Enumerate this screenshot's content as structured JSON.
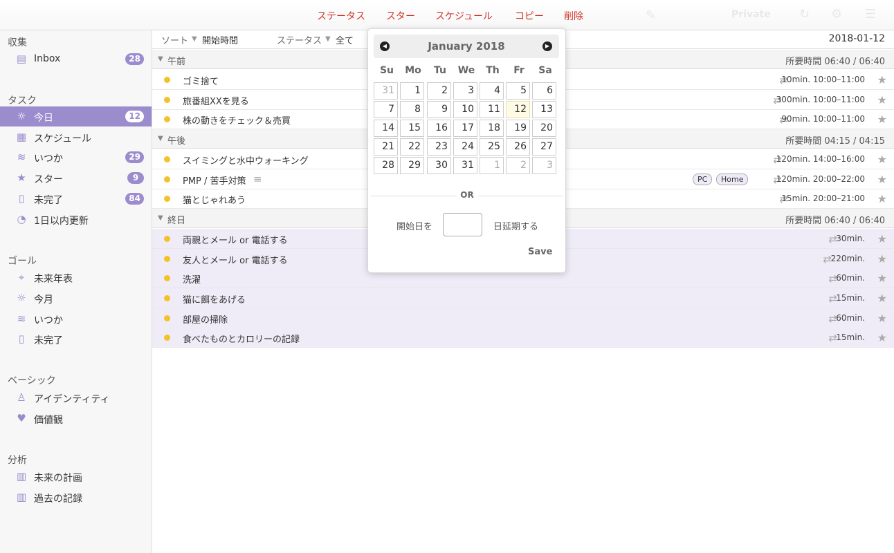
{
  "toolbar_links": [
    "ステータス",
    "スター",
    "スケジュール",
    "コピー",
    "削除"
  ],
  "header_right": {
    "privacy": "Private"
  },
  "sidebar": {
    "sections": [
      "収集",
      "タスク",
      "ゴール",
      "ベーシック",
      "分析"
    ],
    "items": [
      {
        "label": "Inbox",
        "badge": "28",
        "icon": "inbox-icon"
      },
      {
        "label": "今日",
        "badge": "12",
        "icon": "sun-icon"
      },
      {
        "label": "スケジュール",
        "badge": "",
        "icon": "calendar-icon"
      },
      {
        "label": "いつか",
        "badge": "29",
        "icon": "layers-icon"
      },
      {
        "label": "スター",
        "badge": "9",
        "icon": "star-icon"
      },
      {
        "label": "未完了",
        "badge": "84",
        "icon": "document-icon"
      },
      {
        "label": "1日以内更新",
        "badge": "",
        "icon": "stopwatch-icon"
      },
      {
        "label": "未来年表",
        "badge": "",
        "icon": "telescope-icon"
      },
      {
        "label": "今月",
        "badge": "",
        "icon": "sun-icon"
      },
      {
        "label": "いつか",
        "badge": "",
        "icon": "layers-icon"
      },
      {
        "label": "未完了",
        "badge": "",
        "icon": "document-icon"
      },
      {
        "label": "アイデンティティ",
        "badge": "",
        "icon": "person-icon"
      },
      {
        "label": "価値観",
        "badge": "",
        "icon": "heart-icon"
      },
      {
        "label": "未来の計画",
        "badge": "",
        "icon": "chart-icon"
      },
      {
        "label": "過去の記録",
        "badge": "",
        "icon": "chart-icon"
      }
    ]
  },
  "list_toolbar": {
    "sort_label": "ソート",
    "sort_value": "開始時間",
    "status_label": "ステータス",
    "status_value": "全て",
    "date": "2018-01-12"
  },
  "groups": [
    {
      "title": "午前",
      "duration": "所要時間 06:40 / 06:40"
    },
    {
      "title": "午後",
      "duration": "所要時間 04:15 / 04:15"
    },
    {
      "title": "終日",
      "duration": "所要時間 06:40 / 06:40"
    }
  ],
  "tasks": [
    {
      "name": "ゴミ捨て",
      "time": "10min. 10:00–11:00"
    },
    {
      "name": "旅番組XXを見る",
      "time": "300min. 10:00–11:00"
    },
    {
      "name": "株の動きをチェック＆売買",
      "time": "90min. 10:00–11:00"
    },
    {
      "name": "スイミングと水中ウォーキング",
      "time": "120min. 14:00–16:00"
    },
    {
      "name": "PMP / 苦手対策",
      "time": "120min. 20:00–22:00",
      "tags": [
        "PC",
        "Home"
      ]
    },
    {
      "name": "猫とじゃれあう",
      "time": "15min. 20:00–21:00"
    },
    {
      "name": "両親とメール or 電話する",
      "time": "30min."
    },
    {
      "name": "友人とメール or 電話する",
      "time": "220min."
    },
    {
      "name": "洗濯",
      "time": "60min."
    },
    {
      "name": "猫に餌をあげる",
      "time": "15min."
    },
    {
      "name": "部屋の掃除",
      "time": "60min."
    },
    {
      "name": "食べたものとカロリーの記録",
      "time": "15min."
    }
  ],
  "calendar": {
    "title": "January 2018",
    "weekdays": [
      "Su",
      "Mo",
      "Tu",
      "We",
      "Th",
      "Fr",
      "Sa"
    ],
    "days": [
      "31",
      "1",
      "2",
      "3",
      "4",
      "5",
      "6",
      "7",
      "8",
      "9",
      "10",
      "11",
      "12",
      "13",
      "14",
      "15",
      "16",
      "17",
      "18",
      "19",
      "20",
      "21",
      "22",
      "23",
      "24",
      "25",
      "26",
      "27",
      "28",
      "29",
      "30",
      "31",
      "1",
      "2",
      "3"
    ],
    "other_month": [
      0,
      32,
      33,
      34
    ],
    "today": 12,
    "or_label": "OR",
    "delay_prefix": "開始日を",
    "delay_suffix": "日延期する",
    "delay_value": "",
    "save_label": "Save"
  },
  "colors": {
    "accent": "#9b8ccd",
    "link": "#d0342c",
    "dot": "#f3c22b"
  }
}
